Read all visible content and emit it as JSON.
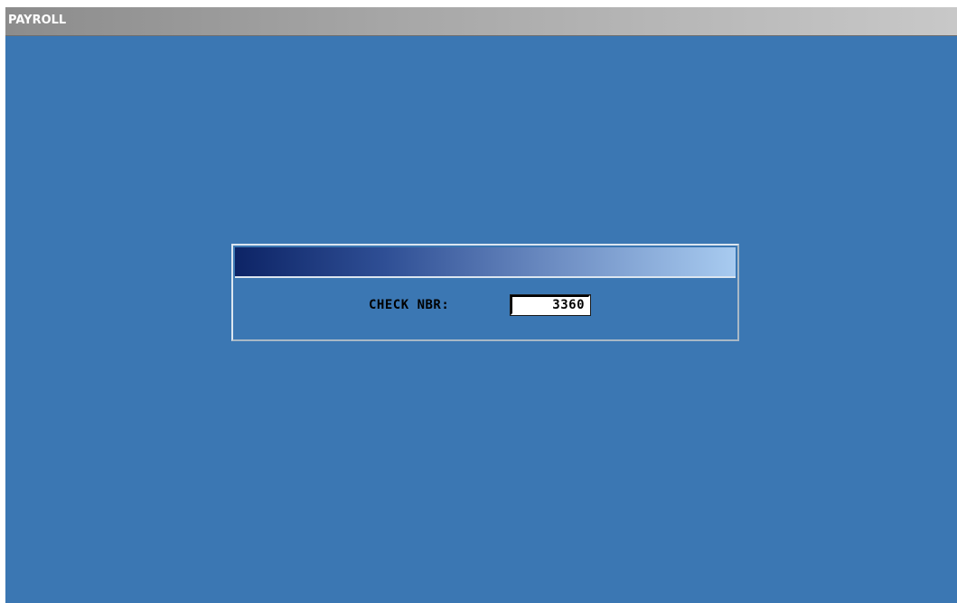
{
  "window": {
    "title": "PAYROLL"
  },
  "dialog": {
    "check_field": {
      "label": "CHECK NBR:",
      "value": "3360"
    }
  },
  "colors": {
    "background": "#3b77b3",
    "title_bar": "#a6a6a6",
    "dialog_header_start": "#0d2466",
    "dialog_header_end": "#a8cbf0"
  }
}
